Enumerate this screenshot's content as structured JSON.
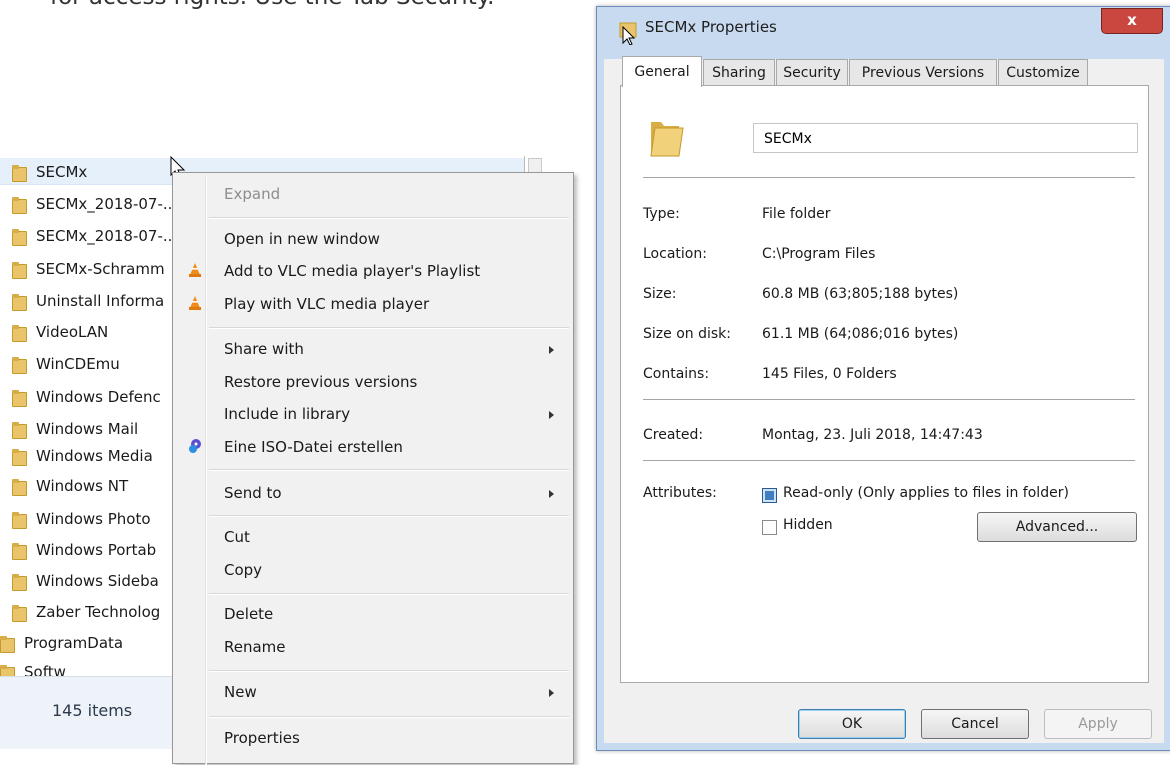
{
  "top_text": "for access rights. Use the Tab Security.",
  "explorer": {
    "items": [
      {
        "label": "SECMx",
        "indent": 1
      },
      {
        "label": "SECMx_2018-07-...",
        "indent": 1
      },
      {
        "label": "SECMx_2018-07-...",
        "indent": 1
      },
      {
        "label": "SECMx-Schramm",
        "indent": 1
      },
      {
        "label": "Uninstall Informa",
        "indent": 1
      },
      {
        "label": "VideoLAN",
        "indent": 1
      },
      {
        "label": "WinCDEmu",
        "indent": 1
      },
      {
        "label": "Windows Defenc",
        "indent": 1
      },
      {
        "label": "Windows Mail",
        "indent": 1
      },
      {
        "label": "Windows Media",
        "indent": 1
      },
      {
        "label": "Windows NT",
        "indent": 1
      },
      {
        "label": "Windows Photo",
        "indent": 1
      },
      {
        "label": "Windows Portab",
        "indent": 1
      },
      {
        "label": "Windows Sideba",
        "indent": 1
      },
      {
        "label": "Zaber Technolog",
        "indent": 1
      },
      {
        "label": "ProgramData",
        "indent": 0
      },
      {
        "label": "Softw",
        "indent": 0
      }
    ],
    "status_count": "145 items"
  },
  "context_menu": {
    "items": [
      {
        "label": "Expand",
        "disabled": true
      },
      {
        "label": "Open in new window"
      },
      {
        "label": "Add to VLC media player's Playlist",
        "icon": "vlc-icon"
      },
      {
        "label": "Play with VLC media player",
        "icon": "vlc-icon"
      },
      {
        "label": "Share with",
        "submenu": true
      },
      {
        "label": "Restore previous versions"
      },
      {
        "label": "Include in library",
        "submenu": true
      },
      {
        "label": "Eine ISO-Datei erstellen",
        "icon": "wincdemu-icon"
      },
      {
        "label": "Send to",
        "submenu": true
      },
      {
        "label": "Cut"
      },
      {
        "label": "Copy"
      },
      {
        "label": "Delete"
      },
      {
        "label": "Rename"
      },
      {
        "label": "New",
        "submenu": true
      },
      {
        "label": "Properties"
      }
    ]
  },
  "dialog": {
    "title": "SECMx Properties",
    "close_label": "x",
    "tabs": [
      "General",
      "Sharing",
      "Security",
      "Previous Versions",
      "Customize"
    ],
    "active_tab": "General",
    "folder_name": "SECMx",
    "properties": {
      "type_label": "Type:",
      "type_value": "File folder",
      "location_label": "Location:",
      "location_value": "C:\\Program Files",
      "size_label": "Size:",
      "size_value": "60.8 MB (63;805;188 bytes)",
      "size_on_disk_label": "Size on disk:",
      "size_on_disk_value": "61.1 MB (64;086;016 bytes)",
      "contains_label": "Contains:",
      "contains_value": "145 Files, 0 Folders",
      "created_label": "Created:",
      "created_value": "Montag, 23. Juli 2018, 14:47:43"
    },
    "attributes": {
      "label": "Attributes:",
      "readonly_label": "Read-only (Only applies to files in folder)",
      "readonly_checked": true,
      "hidden_label": "Hidden",
      "hidden_checked": false,
      "advanced_label": "Advanced..."
    },
    "buttons": {
      "ok": "OK",
      "cancel": "Cancel",
      "apply": "Apply"
    }
  },
  "colors": {
    "accent": "#3e7fc1",
    "close": "#c9473f",
    "vlc": "#f08c1e",
    "folder": "#e9c46a"
  }
}
